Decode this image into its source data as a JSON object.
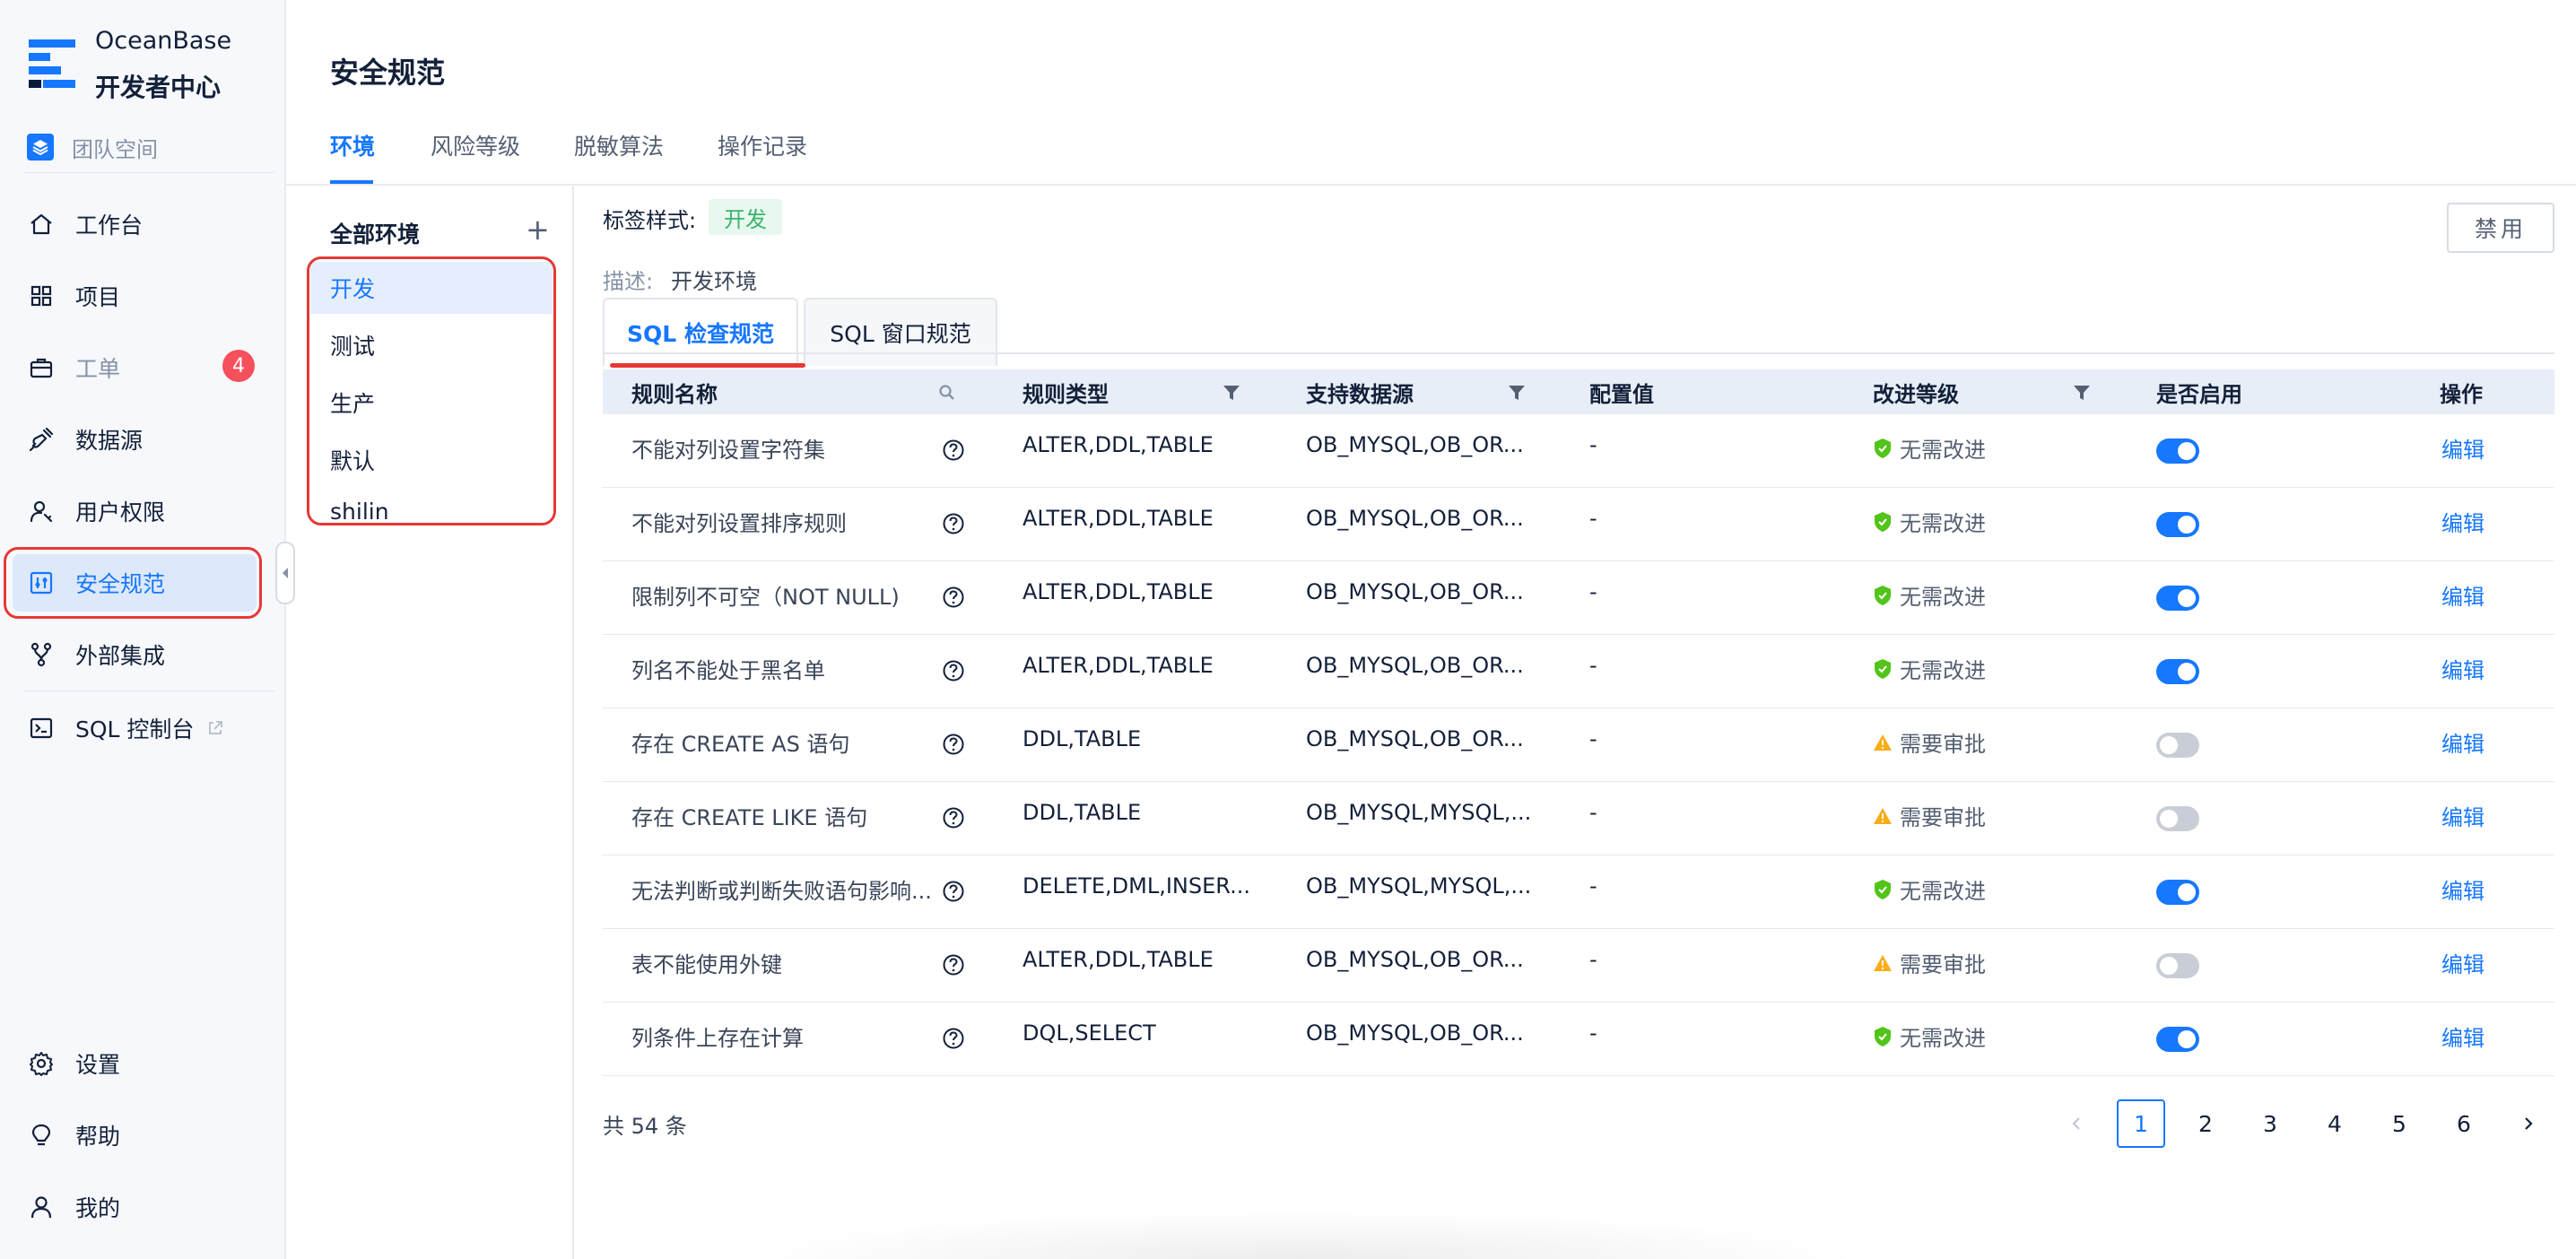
{
  "brand": {
    "line1": "OceanBase",
    "line2": "开发者中心"
  },
  "team_space": "团队空间",
  "nav": [
    {
      "label": "工作台",
      "icon": "home-icon"
    },
    {
      "label": "项目",
      "icon": "grid-icon"
    },
    {
      "label": "工单",
      "icon": "briefcase-icon",
      "badge": "4"
    },
    {
      "label": "数据源",
      "icon": "plug-icon"
    },
    {
      "label": "用户权限",
      "icon": "user-key-icon"
    },
    {
      "label": "安全规范",
      "icon": "shield-settings-icon",
      "active": true
    },
    {
      "label": "外部集成",
      "icon": "integration-icon"
    },
    {
      "label": "SQL 控制台",
      "icon": "terminal-icon"
    }
  ],
  "nav_bottom": [
    {
      "label": "设置",
      "icon": "gear-icon"
    },
    {
      "label": "帮助",
      "icon": "bulb-icon"
    },
    {
      "label": "我的",
      "icon": "user-icon"
    }
  ],
  "page": {
    "title": "安全规范",
    "tabs": [
      "环境",
      "风险等级",
      "脱敏算法",
      "操作记录"
    ],
    "active_tab": "环境"
  },
  "env": {
    "title": "全部环境",
    "add_symbol": "+",
    "items": [
      "开发",
      "测试",
      "生产",
      "默认",
      "shilin"
    ],
    "active": "开发"
  },
  "detail": {
    "tag_label": "标签样式:",
    "tag_value": "开发",
    "desc_label": "描述:",
    "desc_value": "开发环境",
    "disable_btn": "禁用",
    "subtabs": [
      "SQL 检查规范",
      "SQL 窗口规范"
    ]
  },
  "table": {
    "columns": [
      "规则名称",
      "规则类型",
      "支持数据源",
      "配置值",
      "改进等级",
      "是否启用",
      "操作"
    ],
    "rows": [
      {
        "name": "不能对列设置字符集",
        "type": "ALTER,DDL,TABLE",
        "ds": "OB_MYSQL,OB_OR...",
        "val": "-",
        "level": "无需改进",
        "lvl": "ok",
        "enabled": true,
        "op": "编辑"
      },
      {
        "name": "不能对列设置排序规则",
        "type": "ALTER,DDL,TABLE",
        "ds": "OB_MYSQL,OB_OR...",
        "val": "-",
        "level": "无需改进",
        "lvl": "ok",
        "enabled": true,
        "op": "编辑"
      },
      {
        "name": "限制列不可空（NOT NULL)",
        "type": "ALTER,DDL,TABLE",
        "ds": "OB_MYSQL,OB_OR...",
        "val": "-",
        "level": "无需改进",
        "lvl": "ok",
        "enabled": true,
        "op": "编辑"
      },
      {
        "name": "列名不能处于黑名单",
        "type": "ALTER,DDL,TABLE",
        "ds": "OB_MYSQL,OB_OR...",
        "val": "-",
        "level": "无需改进",
        "lvl": "ok",
        "enabled": true,
        "op": "编辑"
      },
      {
        "name": "存在 CREATE AS 语句",
        "type": "DDL,TABLE",
        "ds": "OB_MYSQL,OB_OR...",
        "val": "-",
        "level": "需要审批",
        "lvl": "warn",
        "enabled": false,
        "op": "编辑"
      },
      {
        "name": "存在 CREATE LIKE 语句",
        "type": "DDL,TABLE",
        "ds": "OB_MYSQL,MYSQL,...",
        "val": "-",
        "level": "需要审批",
        "lvl": "warn",
        "enabled": false,
        "op": "编辑"
      },
      {
        "name": "无法判断或判断失败语句影响...",
        "type": "DELETE,DML,INSER...",
        "ds": "OB_MYSQL,MYSQL,...",
        "val": "-",
        "level": "无需改进",
        "lvl": "ok",
        "enabled": true,
        "op": "编辑"
      },
      {
        "name": "表不能使用外键",
        "type": "ALTER,DDL,TABLE",
        "ds": "OB_MYSQL,OB_OR...",
        "val": "-",
        "level": "需要审批",
        "lvl": "warn",
        "enabled": false,
        "op": "编辑"
      },
      {
        "name": "列条件上存在计算",
        "type": "DQL,SELECT",
        "ds": "OB_MYSQL,OB_OR...",
        "val": "-",
        "level": "无需改进",
        "lvl": "ok",
        "enabled": true,
        "op": "编辑"
      }
    ]
  },
  "pagination": {
    "total": "共 54 条",
    "pages": [
      "1",
      "2",
      "3",
      "4",
      "5",
      "6"
    ],
    "current": "1",
    "prev": "<",
    "next": ">"
  },
  "colors": {
    "accent": "#1677ff",
    "ok": "#52c41a",
    "warn": "#faad14",
    "highlight": "#e53935"
  }
}
